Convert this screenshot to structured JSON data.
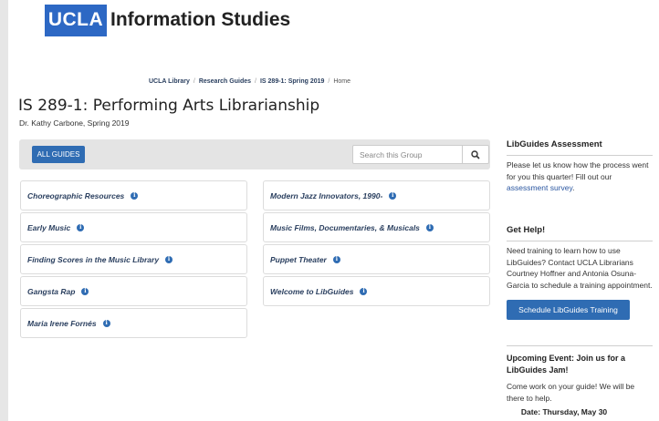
{
  "header": {
    "logo_mark": "UCLA",
    "logo_text": "Information Studies"
  },
  "breadcrumb": {
    "items": [
      "UCLA Library",
      "Research Guides",
      "IS 289-1: Spring 2019",
      "Home"
    ],
    "separator": "/"
  },
  "page": {
    "title": "IS 289-1: Performing Arts Librarianship",
    "subtitle": "Dr. Kathy Carbone, Spring 2019"
  },
  "group_bar": {
    "all_guides_label": "ALL GUIDES",
    "search_placeholder": "Search this Group",
    "search_icon": "search-icon"
  },
  "guides": {
    "left": [
      "Choreographic Resources",
      "Early Music",
      "Finding Scores in the Music Library",
      "Gangsta Rap",
      "Maria Irene Fornés"
    ],
    "right": [
      "Modern Jazz Innovators, 1990-",
      "Music Films, Documentaries, & Musicals",
      "Puppet Theater",
      "Welcome to LibGuides"
    ],
    "info_glyph": "i"
  },
  "sidebar": {
    "assessment": {
      "heading": "LibGuides Assessment",
      "text": "Please let us know how the process went for you this quarter! Fill out our",
      "link": "assessment survey",
      "after_link": "."
    },
    "help": {
      "heading": "Get Help!",
      "text": "Need training to learn how to use LibGuides? Contact UCLA Librarians Courtney Hoffner and Antonia Osuna-Garcia to schedule a training appointment.",
      "button_label": "Schedule LibGuides Training"
    },
    "event": {
      "heading": "Upcoming Event: Join us for a LibGuides Jam!",
      "text": "Come work on your guide! We will be there to help.",
      "date": "Date: Thursday, May 30"
    }
  },
  "colors": {
    "brand_blue": "#2d68c4",
    "button_blue": "#2f6cb3",
    "link_navy": "#2a3f5f"
  }
}
